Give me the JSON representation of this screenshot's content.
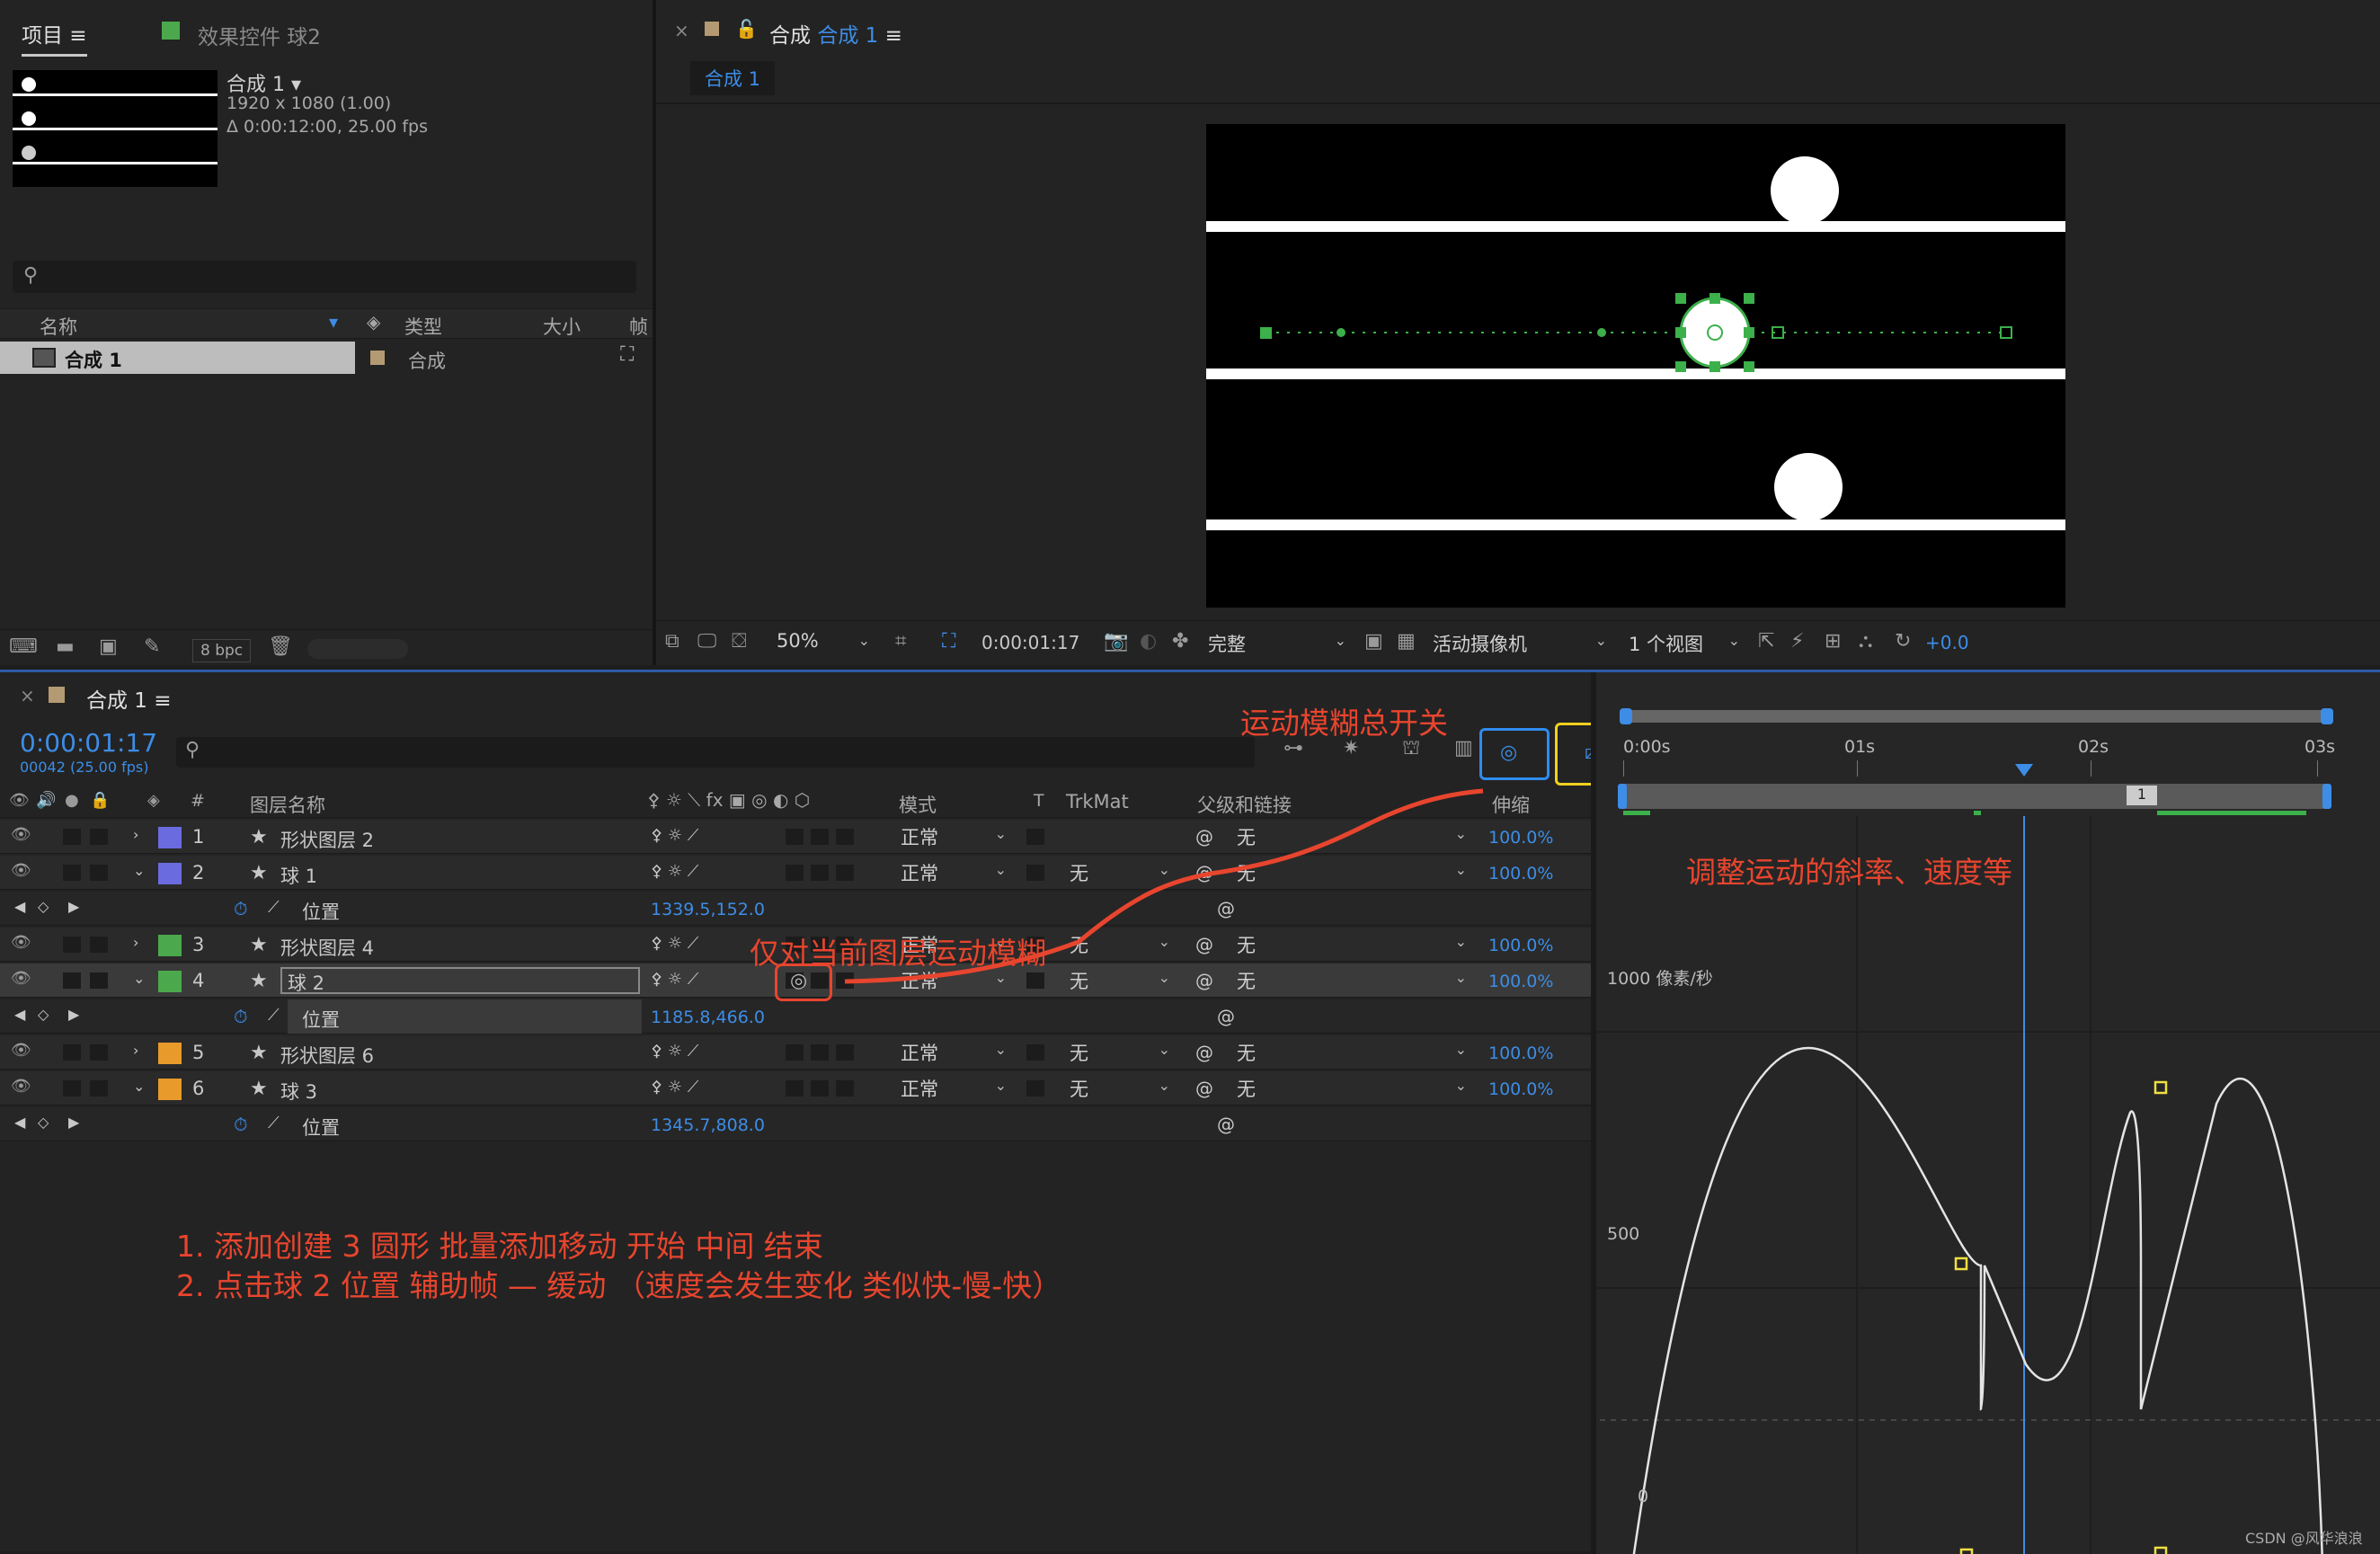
{
  "project": {
    "tab_project": "项目",
    "tab_effects": "效果控件 球2",
    "comp_name": "合成 1",
    "comp_size": "1920 x 1080 (1.00)",
    "comp_duration": "Δ 0:00:12:00, 25.00 fps",
    "search_placeholder": "",
    "col_name": "名称",
    "col_type": "类型",
    "col_size": "大小",
    "col_frame": "帧",
    "item_name": "合成 1",
    "item_type": "合成",
    "bpc": "8 bpc"
  },
  "viewer": {
    "tab_label": "合成",
    "tab_comp": "合成 1",
    "subtab": "合成 1",
    "zoom": "50%",
    "timecode": "0:00:01:17",
    "quality": "完整",
    "camera": "活动摄像机",
    "views": "1 个视图",
    "exposure": "+0.0"
  },
  "timeline": {
    "title": "合成 1",
    "timecode": "0:00:01:17",
    "frames": "00042 (25.00 fps)",
    "col_name": "图层名称",
    "col_mode": "模式",
    "col_t": "T",
    "col_trkmat": "TrkMat",
    "col_parent": "父级和链接",
    "col_stretch": "伸缩",
    "col_hash": "#",
    "ruler": [
      "0:00s",
      "01s",
      "02s",
      "03s"
    ],
    "marker": "1",
    "layers": [
      {
        "num": "1",
        "name": "形状图层 2",
        "color": "#6b6be0",
        "mode": "正常",
        "trk": "",
        "parent": "无",
        "stretch": "100.0%",
        "expanded": false
      },
      {
        "num": "2",
        "name": "球 1",
        "color": "#6b6be0",
        "mode": "正常",
        "trk": "无",
        "parent": "无",
        "stretch": "100.0%",
        "expanded": true,
        "prop": "位置",
        "value": "1339.5,152.0"
      },
      {
        "num": "3",
        "name": "形状图层 4",
        "color": "#4ca84c",
        "mode": "正常",
        "trk": "无",
        "parent": "无",
        "stretch": "100.0%",
        "expanded": false
      },
      {
        "num": "4",
        "name": "球 2",
        "color": "#4ca84c",
        "mode": "正常",
        "trk": "无",
        "parent": "无",
        "stretch": "100.0%",
        "expanded": true,
        "prop": "位置",
        "value": "1185.8,466.0"
      },
      {
        "num": "5",
        "name": "形状图层 6",
        "color": "#e89a2a",
        "mode": "正常",
        "trk": "无",
        "parent": "无",
        "stretch": "100.0%",
        "expanded": false
      },
      {
        "num": "6",
        "name": "球 3",
        "color": "#e89a2a",
        "mode": "正常",
        "trk": "无",
        "parent": "无",
        "stretch": "100.0%",
        "expanded": true,
        "prop": "位置",
        "value": "1345.7,808.0"
      }
    ],
    "graph_labels": {
      "y1000": "1000 像素/秒",
      "y500": "500",
      "y0": "0"
    }
  },
  "annotations": {
    "motion_blur_master": "运动模糊总开关",
    "graph_hint": "调整运动的斜率、速度等",
    "layer_blur": "仅对当前图层运动模糊",
    "step1": "1. 添加创建 3 圆形    批量添加移动 开始    中间      结束",
    "step2": "2. 点击球 2 位置      辅助帧 — 缓动     （速度会发生变化   类似快-慢-快）"
  },
  "watermark": "CSDN @风华浪浪",
  "colors": {
    "accent": "#3d8de6",
    "annotation_red": "#e8452e",
    "highlight_blue": "#2f8cf0",
    "highlight_yellow": "#f0d020",
    "keyframe_yellow": "#f0e040"
  }
}
